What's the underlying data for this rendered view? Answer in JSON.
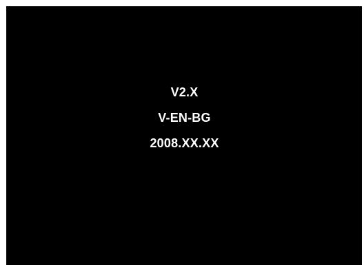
{
  "screen": {
    "background": "#000000",
    "text_color": "#ffffff",
    "lines": {
      "version": "V2.X",
      "variant": "V-EN-BG",
      "date": "2008.XX.XX"
    }
  }
}
